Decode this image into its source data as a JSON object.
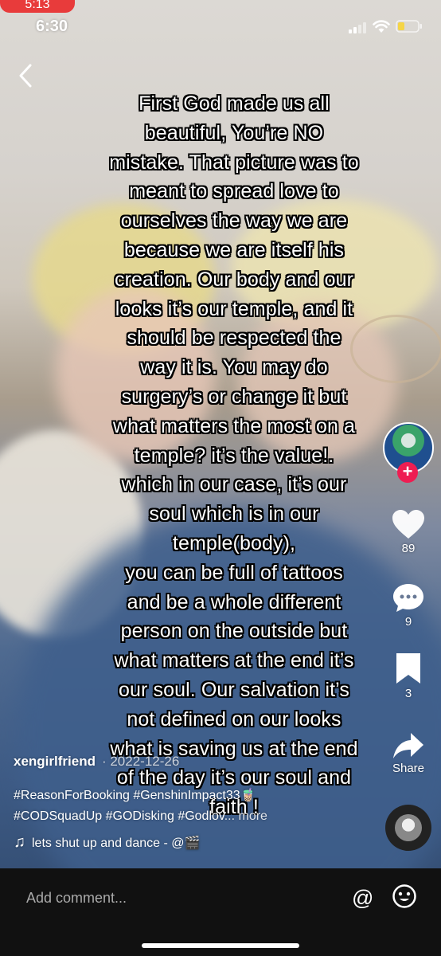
{
  "status_bar": {
    "prev_app_time": "5:13",
    "time": "6:30"
  },
  "overlay_text": "First God made us all\nbeautiful, You’re NO\nmistake. That picture was to\nmeant to spread love to\nourselves the way we are\nbecause we are itself his\ncreation. Our body and our\nlooks it’s our temple, and it\nshould be respected the\nway it is. You may do\nsurgery’s or change it but\nwhat matters the most on a\ntemple? it’s the value!.\nwhich in our case, it’s our\nsoul which is in our\ntemple(body),\nyou can be full of tattoos\nand be a whole different\nperson on the outside but\nwhat matters at the end it’s\nour soul. Our salvation it’s\nnot defined on our looks\nwhat is saving us at the end\nof the day it’s our soul and\nfaith !",
  "rail": {
    "likes": "89",
    "comments": "9",
    "saves": "3",
    "share_label": "Share"
  },
  "caption": {
    "username": "xengirlfriend",
    "date": "· 2022-12-26",
    "hashtags_line1": "#ReasonForBooking #GenshinImpact33🧋",
    "hashtags_line2": "#CODSquadUp #GODisking #Godlov",
    "more": "... more",
    "music": "lets shut up and dance - @🎬"
  },
  "comment_bar": {
    "placeholder": "Add comment..."
  },
  "icons": {
    "back": "chevron-left-icon",
    "like": "heart-icon",
    "comment": "speech-bubble-icon",
    "save": "bookmark-icon",
    "share": "share-arrow-icon",
    "music": "music-note-icon",
    "mention": "at-sign-icon",
    "emoji": "smiley-icon"
  },
  "colors": {
    "follow_button": "#ee1d52",
    "prev_app_badge": "#e83b3b",
    "comment_bar_bg": "#111111"
  }
}
